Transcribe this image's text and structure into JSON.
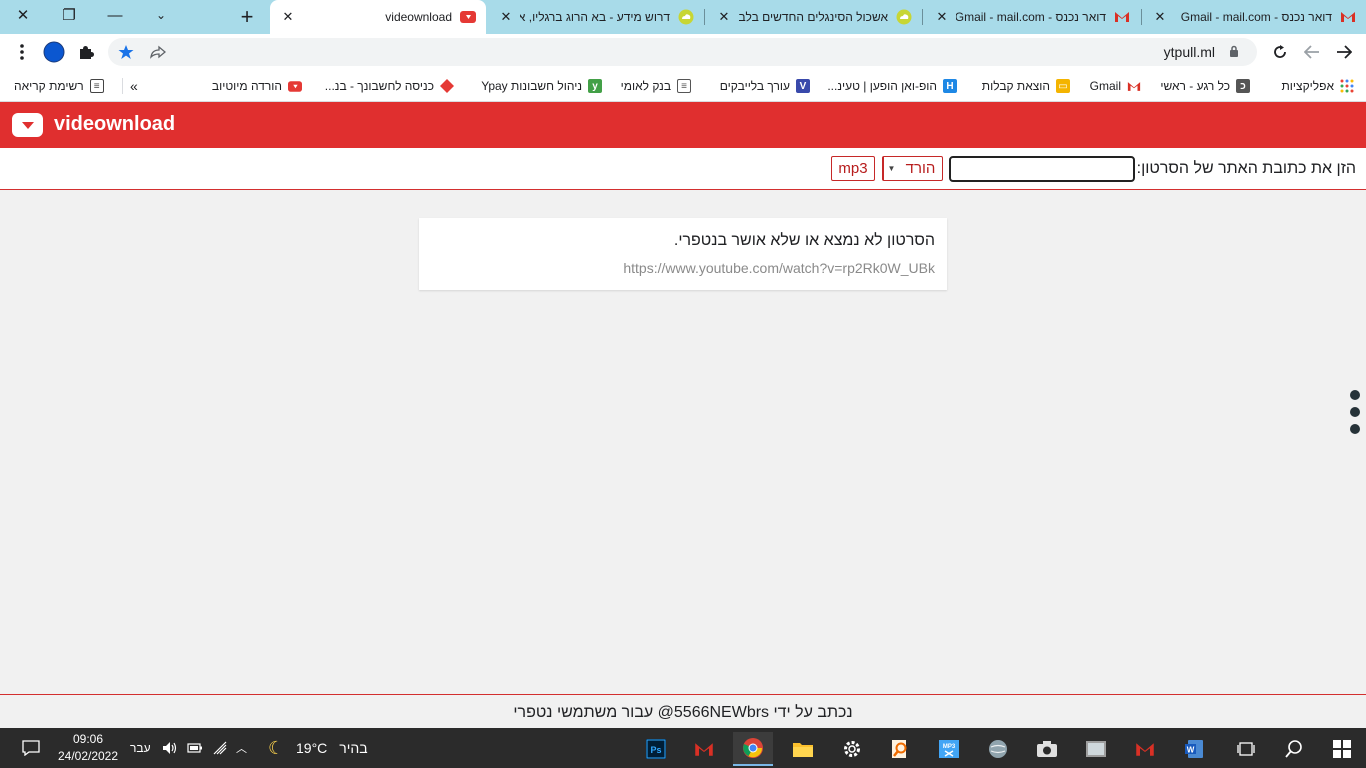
{
  "browser": {
    "tabs": [
      {
        "title": "דואר נכנס - Gmail - mail.com",
        "icon": "gmail-icon",
        "active": false
      },
      {
        "title": "דואר נכנס - Gmail - mail.com",
        "icon": "gmail-icon",
        "active": false
      },
      {
        "title": "אשכול הסינגלים החדשים בלב",
        "icon": "cloud-icon",
        "active": false
      },
      {
        "title": "דרוש מידע - בא הרוג ברגליו, א",
        "icon": "cloud-icon",
        "active": false
      },
      {
        "title": "videownload",
        "icon": "youtube-icon",
        "active": true
      }
    ],
    "url": "ytpull.ml"
  },
  "bookmarks": [
    {
      "label": "אפליקציות",
      "icon": "apps-grid-icon",
      "color": "#e53935"
    },
    {
      "label": "כל רגע - ראשי",
      "icon": "news-icon",
      "color": "#555555"
    },
    {
      "label": "Gmail",
      "icon": "gmail-icon",
      "color": "#d93025"
    },
    {
      "label": "הוצאת קבלות",
      "icon": "briefcase-icon",
      "color": "#f4b400"
    },
    {
      "label": "הופ-ואן הופען | טעינ...",
      "icon": "h-icon",
      "color": "#1e88e5"
    },
    {
      "label": "עורך בלייבקים",
      "icon": "v-icon",
      "color": "#3949ab"
    },
    {
      "label": "בנק לאומי",
      "icon": "doc-icon",
      "color": "#555555"
    },
    {
      "label": "ניהול חשבונות Ypay",
      "icon": "ypay-icon",
      "color": "#43a047"
    },
    {
      "label": "כניסה לחשבונך - בנ...",
      "icon": "diamond-icon",
      "color": "#e53935"
    },
    {
      "label": "הורדה מיוטיוב",
      "icon": "youtube-icon",
      "color": "#e53935"
    },
    {
      "label": "רשימת קריאה",
      "icon": "reading-list-icon",
      "color": "#444444"
    }
  ],
  "site": {
    "name": "videownload",
    "form_label": "הזן את כתובת האתר של הסרטון:",
    "input_value": "",
    "download_label": "הורד",
    "mp3_label": "mp3",
    "message_title": "הסרטון לא נמצא או שלא אושר בנטפרי.",
    "message_url": "https://www.youtube.com/watch?v=rp2Rk0W_UBk",
    "footer": "נכתב על ידי 5566NEWbrs@ עבור משתמשי נטפרי",
    "accent_color": "#e02f2f"
  },
  "taskbar": {
    "time": "09:06",
    "date": "24/02/2022",
    "language": "עבר",
    "temperature": "19°C",
    "weather": "בהיר"
  }
}
